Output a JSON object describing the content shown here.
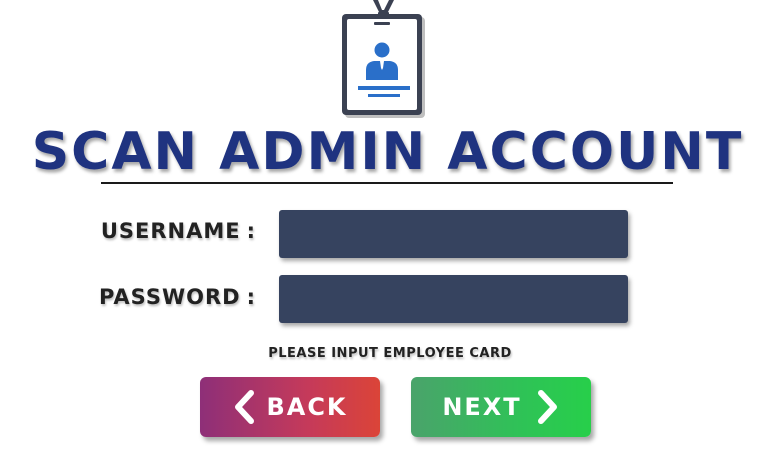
{
  "title": "SCAN ADMIN ACCOUNT",
  "form": {
    "username_label": "USERNAME",
    "password_label": "PASSWORD",
    "colon": ":",
    "username_value": "",
    "password_value": ""
  },
  "hint": "PLEASE INPUT EMPLOYEE CARD",
  "buttons": {
    "back_label": "BACK",
    "next_label": "NEXT"
  },
  "icons": {
    "badge": "employee-id-badge-icon",
    "back": "chevron-left-icon",
    "next": "chevron-right-icon"
  },
  "colors": {
    "title": "#1f3380",
    "input_bg": "#36435f",
    "back_gradient_start": "#8e2f78",
    "back_gradient_end": "#db4438",
    "next_gradient_start": "#4aa36b",
    "next_gradient_end": "#27cf4a",
    "badge_accent": "#2a6fc9"
  }
}
